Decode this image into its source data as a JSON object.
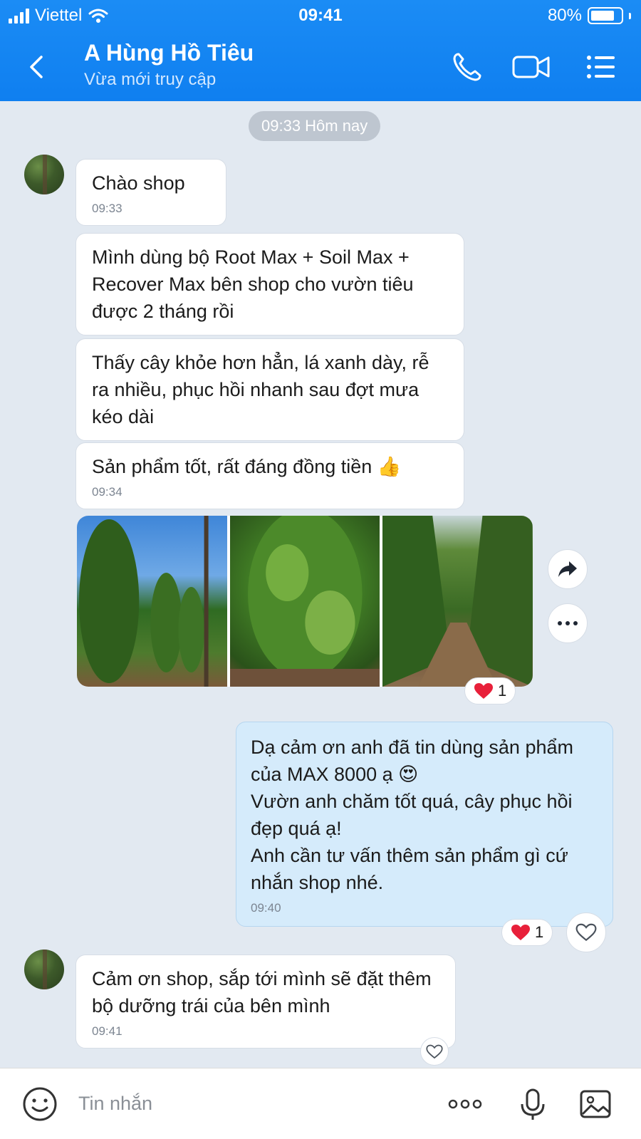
{
  "status_bar": {
    "carrier": "Viettel",
    "time": "09:41",
    "battery": "80%",
    "battery_level": 0.8
  },
  "header": {
    "title": "A Hùng Hồ Tiêu",
    "subtitle": "Vừa mới truy cập"
  },
  "date_chip": "09:33 Hôm nay",
  "messages": [
    {
      "text": "Chào shop",
      "time": "09:33"
    },
    {
      "text": "Mình dùng bộ Root Max + Soil Max + Recover Max bên shop cho vườn tiêu được 2 tháng rồi"
    },
    {
      "text": "Thấy cây khỏe hơn hẳn, lá xanh dày, rễ ra nhiều, phục hồi nhanh sau đợt mưa kéo dài"
    },
    {
      "text": "Sản phẩm tốt, rất đáng đồng tiền 👍",
      "time": "09:34"
    },
    {
      "reaction": "❤️",
      "reaction_count": "1"
    },
    {
      "lines": [
        "Dạ cảm ơn anh đã tin dùng sản phẩm",
        "của MAX 8000 ạ 😍",
        "Vườn anh chăm tốt quá, cây phục hồi",
        "đẹp quá ạ!",
        "Anh cần tư vấn thêm sản phẩm gì cứ",
        "nhắn shop nhé."
      ],
      "time": "09:40",
      "reaction": "❤️",
      "reaction_count": "1"
    },
    {
      "text": "Cảm ơn shop, sắp tới mình sẽ đặt thêm bộ dưỡng trái của bên mình",
      "time": "09:41"
    }
  ],
  "input": {
    "placeholder": "Tin nhắn"
  },
  "colors": {
    "header": "#0f7ff0",
    "background": "#e2e9f1",
    "outgoing_bubble": "#d5ebfb",
    "heart": "#e8203a"
  },
  "icons": [
    "back-icon",
    "phone-icon",
    "video-icon",
    "menu-list-icon",
    "share-icon",
    "more-icon",
    "heart-icon",
    "emoji-icon",
    "dots-icon",
    "mic-icon",
    "gallery-icon"
  ]
}
